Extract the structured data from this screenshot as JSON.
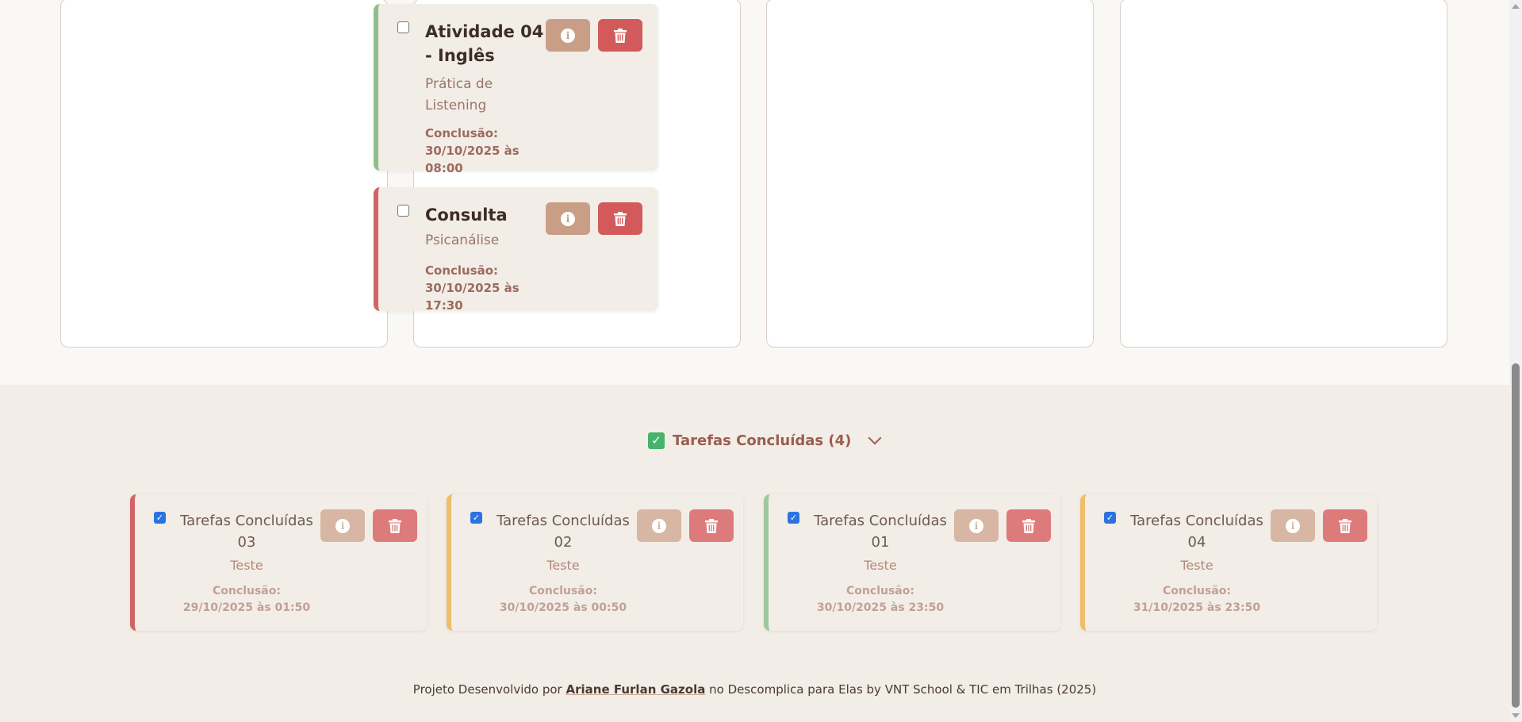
{
  "active_tasks": [
    {
      "title": "Atividade 04 - Inglês",
      "description": "Prática de Listening",
      "conclusion": "Conclusão: 30/10/2025 às 08:00",
      "accent": "#8dc08a"
    },
    {
      "title": "Consulta",
      "description": "Psicanálise",
      "conclusion": "Conclusão: 30/10/2025 às 17:30",
      "accent": "#d06565"
    }
  ],
  "completed": {
    "header": "Tarefas Concluídas (4)",
    "tasks": [
      {
        "title": "Tarefas Concluídas 03",
        "description": "Teste",
        "conclusion": "Conclusão: 29/10/2025 às 01:50",
        "accent": "#d06565"
      },
      {
        "title": "Tarefas Concluídas 02",
        "description": "Teste",
        "conclusion": "Conclusão: 30/10/2025 às 00:50",
        "accent": "#ecbe6d"
      },
      {
        "title": "Tarefas Concluídas 01",
        "description": "Teste",
        "conclusion": "Conclusão: 30/10/2025 às 23:50",
        "accent": "#9cc89a"
      },
      {
        "title": "Tarefas Concluídas 04",
        "description": "Teste",
        "conclusion": "Conclusão: 31/10/2025 às 23:50",
        "accent": "#ecbe6d"
      }
    ]
  },
  "footer": {
    "prefix": "Projeto Desenvolvido por",
    "author": "Ariane Furlan Gazola",
    "suffix": "no Descomplica para Elas by VNT School & TIC em Trilhas (2025)"
  },
  "colors": {
    "background": "#faf8f5",
    "card": "#f3ede7",
    "info_button": "#c89f86",
    "delete_button": "#d35a5a",
    "heading": "#9b5d4f"
  },
  "icons": {
    "info": "info-icon",
    "delete": "trash-icon",
    "expand": "chevron-down-icon",
    "completed": "check-mark-icon"
  }
}
